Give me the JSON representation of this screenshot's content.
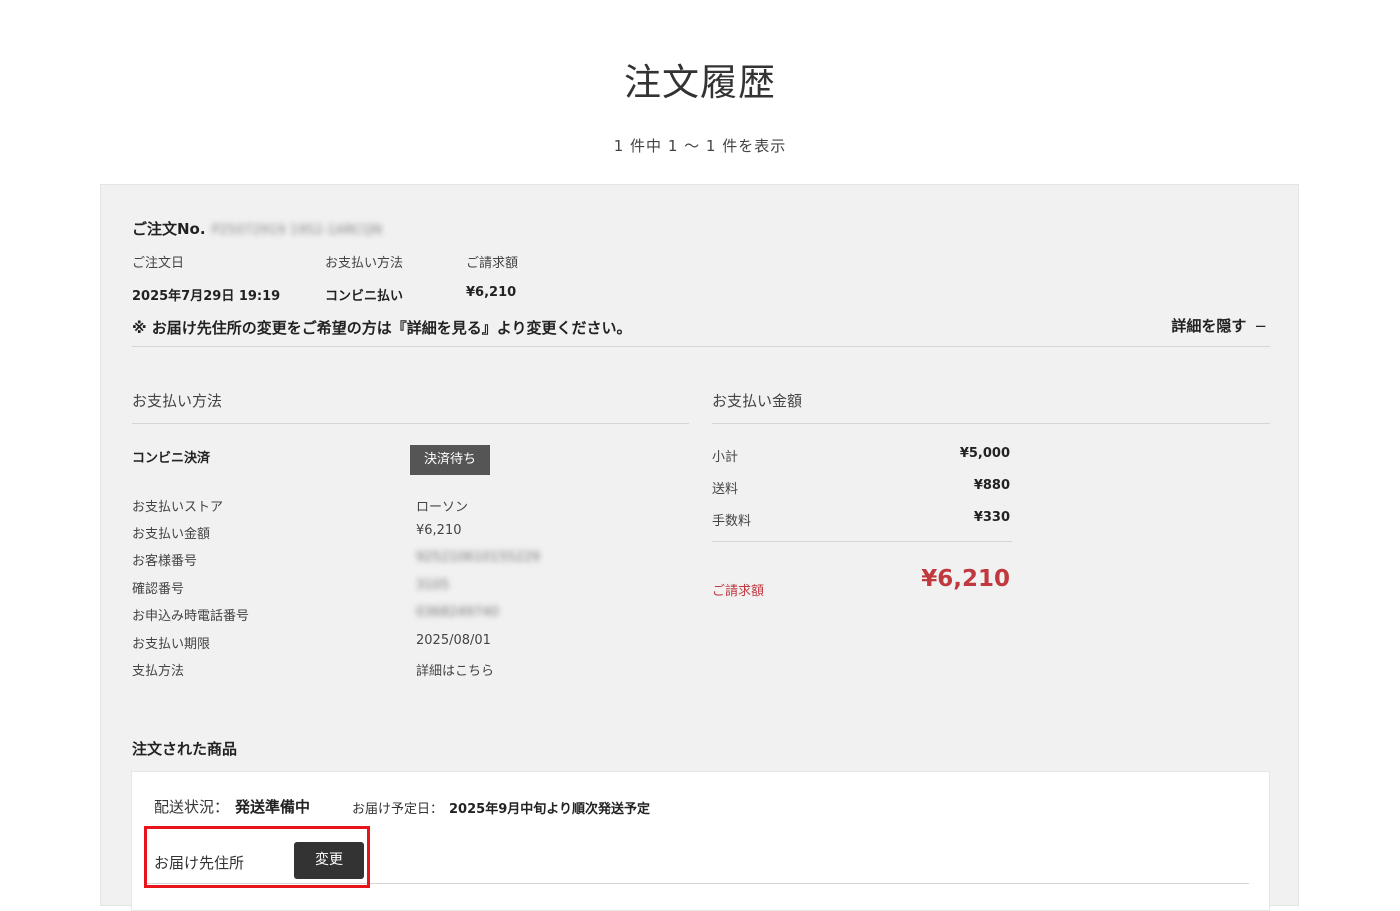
{
  "page": {
    "title": "注文履歴",
    "result_count": "1 件中 1 〜 1 件を表示"
  },
  "order": {
    "order_no_label": "ご注文No.",
    "order_no_value": "P25072919 1952-1ARCQN",
    "meta": {
      "date_label": "ご注文日",
      "date_value": "2025年7月29日 19:19",
      "method_label": "お支払い方法",
      "method_value": "コンビニ払い",
      "billing_label": "ご請求額",
      "billing_value": "¥6,210"
    },
    "notice": "※ お届け先住所の変更をご希望の方は『詳細を見る』より変更ください。",
    "toggle_label": "詳細を隠す",
    "toggle_icon": "−"
  },
  "payment": {
    "section_title": "お支払い方法",
    "method_name": "コンビニ決済",
    "status_badge": "決済待ち",
    "rows": [
      {
        "label": "お支払いストア",
        "value": "ローソン"
      },
      {
        "label": "お支払い金額",
        "value": "¥6,210"
      },
      {
        "label": "お客様番号",
        "value": "925210610155229"
      },
      {
        "label": "確認番号",
        "value": "3105"
      },
      {
        "label": "お申込み時電話番号",
        "value": "0368249740"
      },
      {
        "label": "お支払い期限",
        "value": "2025/08/01"
      },
      {
        "label": "支払方法",
        "value": "詳細はこちら"
      }
    ]
  },
  "amount": {
    "section_title": "お支払い金額",
    "rows": [
      {
        "label": "小計",
        "value": "¥5,000"
      },
      {
        "label": "送料",
        "value": "¥880"
      },
      {
        "label": "手数料",
        "value": "¥330"
      }
    ],
    "total_label": "ご請求額",
    "total_value": "¥6,210",
    "accent_color": "#c0393f"
  },
  "items": {
    "section_title": "注文された商品",
    "shipping_status_label": "配送状況：",
    "shipping_status_value": "発送準備中",
    "eta_label": "お届け予定日：",
    "eta_value": "2025年9月中旬より順次発送予定",
    "address_label": "お届け先住所",
    "change_button": "変更",
    "highlight_color": "#e8141c"
  }
}
